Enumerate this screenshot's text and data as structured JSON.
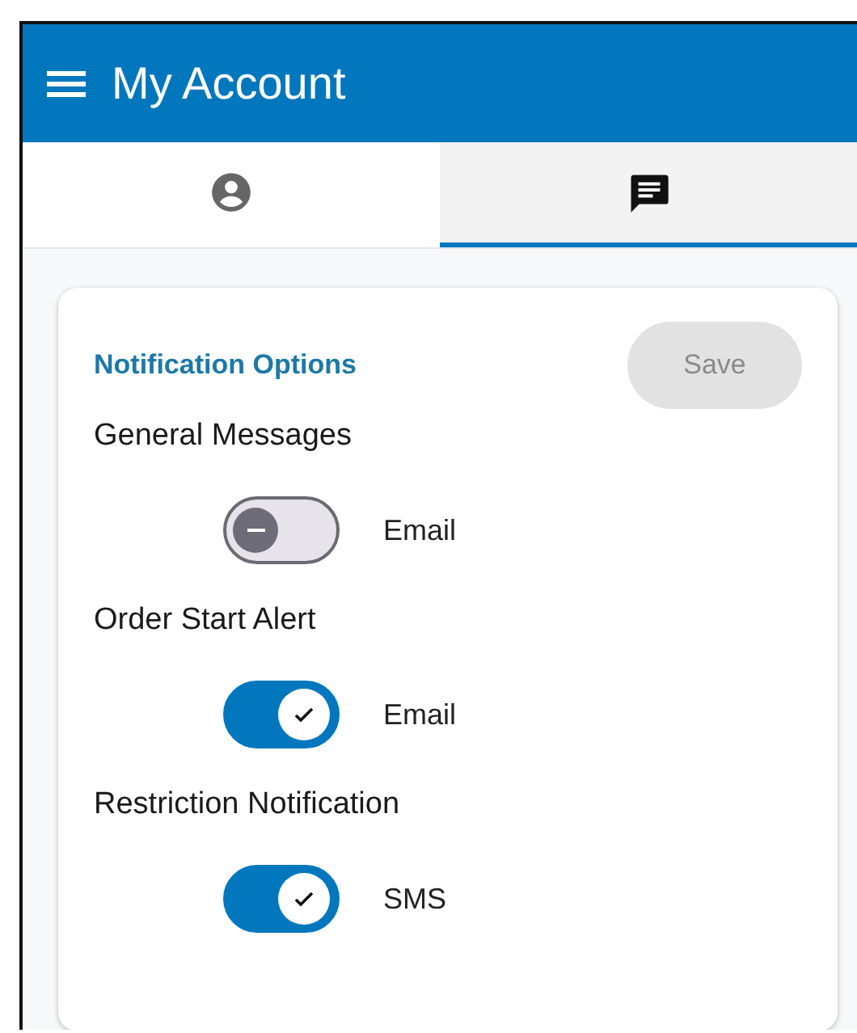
{
  "app_bar": {
    "title": "My Account"
  },
  "tabs": [
    {
      "kind": "person",
      "selected": false
    },
    {
      "kind": "message",
      "selected": true
    }
  ],
  "card": {
    "title": "Notification Options",
    "save_button": {
      "label": "Save",
      "disabled": true
    },
    "groups": [
      {
        "title": "General Messages",
        "toggle": {
          "label": "Email",
          "checked": false
        }
      },
      {
        "title": "Order Start Alert",
        "toggle": {
          "label": "Email",
          "checked": true
        }
      },
      {
        "title": "Restriction Notification",
        "toggle": {
          "label": "SMS",
          "checked": true
        }
      }
    ]
  }
}
